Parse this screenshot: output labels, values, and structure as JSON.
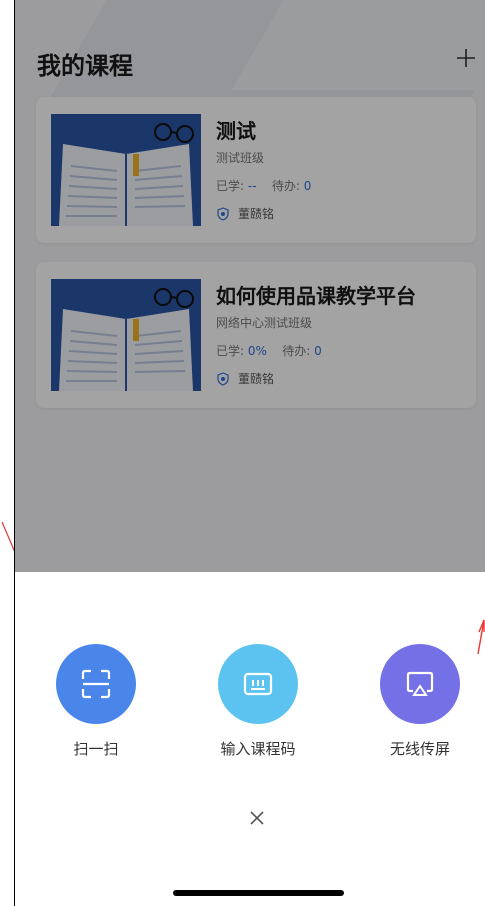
{
  "page": {
    "title": "我的课程"
  },
  "courses": [
    {
      "title": "测试",
      "class_name": "测试班级",
      "learned_label": "已学:",
      "learned_value": "--",
      "todo_label": "待办:",
      "todo_value": "0",
      "teacher": "董赜铭"
    },
    {
      "title": "如何使用品课教学平台",
      "class_name": "网络中心测试班级",
      "learned_label": "已学:",
      "learned_value": "0%",
      "todo_label": "待办:",
      "todo_value": "0",
      "teacher": "董赜铭"
    }
  ],
  "sheet": {
    "actions": [
      {
        "label": "扫一扫",
        "icon": "scan-icon",
        "color": "#4a86ea"
      },
      {
        "label": "输入课程码",
        "icon": "code-input-icon",
        "color": "#5cc3f0"
      },
      {
        "label": "无线传屏",
        "icon": "screen-cast-icon",
        "color": "#7470e6"
      }
    ],
    "close_icon": "close-icon"
  },
  "colors": {
    "accent": "#2f6fd6",
    "arrow": "#e53935"
  }
}
